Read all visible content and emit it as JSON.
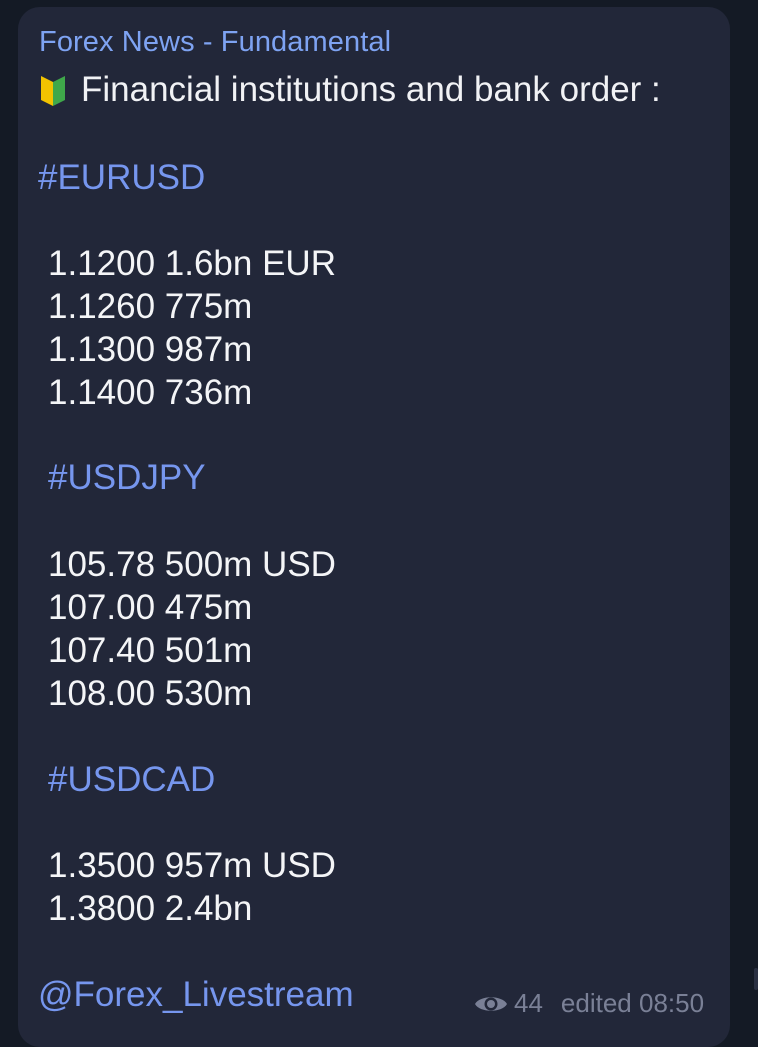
{
  "message": {
    "sender": "Forex News - Fundamental",
    "headline": "Financial institutions and bank order :",
    "headline_icon": "beginner-badge-icon",
    "sections": [
      {
        "hashtag": "#EURUSD",
        "lines": [
          "1.1200 1.6bn EUR",
          "1.1260 775m",
          "1.1300 987m",
          "1.1400 736m"
        ]
      },
      {
        "hashtag": "#USDJPY",
        "lines": [
          "105.78 500m USD",
          "107.00 475m",
          "107.40 501m",
          "108.00 530m"
        ]
      },
      {
        "hashtag": "#USDCAD",
        "lines": [
          "1.3500 957m USD",
          "1.3800 2.4bn"
        ]
      }
    ],
    "signature": "@Forex_Livestream",
    "views": "44",
    "edited": "edited 08:50"
  },
  "colors": {
    "background": "#141a25",
    "bubble": "#222739",
    "sender": "#7ea3f2",
    "link": "#7696ee",
    "text": "#f4f5f7",
    "meta": "#7a8096"
  }
}
